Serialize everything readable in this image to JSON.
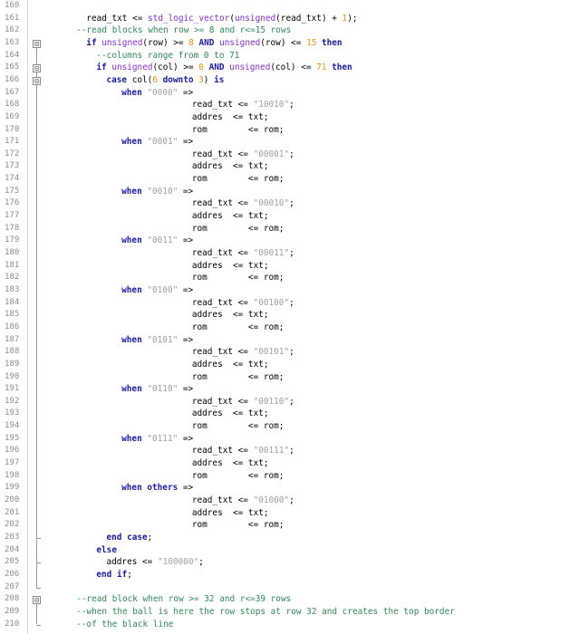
{
  "editor": {
    "line_numbers": [
      "160",
      "161",
      "162",
      "163",
      "164",
      "165",
      "166",
      "167",
      "168",
      "169",
      "170",
      "171",
      "172",
      "173",
      "174",
      "175",
      "176",
      "177",
      "178",
      "179",
      "180",
      "181",
      "182",
      "183",
      "184",
      "185",
      "186",
      "187",
      "188",
      "189",
      "190",
      "191",
      "192",
      "193",
      "194",
      "195",
      "196",
      "197",
      "198",
      "199",
      "200",
      "201",
      "202",
      "203",
      "204",
      "205",
      "206",
      "207",
      "208",
      "209",
      "210"
    ],
    "colors": {
      "keyword": "#1a1aa6",
      "function": "#8a2be2",
      "string": "#a0a0a0",
      "number": "#ff8c00",
      "comment": "#2e8b57",
      "gutter_text": "#8c8c8c"
    },
    "lines": [
      {
        "indent": 0,
        "tokens": []
      },
      {
        "indent": 6,
        "tokens": [
          [
            "t",
            "read_txt <= "
          ],
          [
            "fn",
            "std_logic_vector"
          ],
          [
            "t",
            "("
          ],
          [
            "fn",
            "unsigned"
          ],
          [
            "t",
            "(read_txt) + "
          ],
          [
            "num",
            "1"
          ],
          [
            "t",
            ");"
          ]
        ]
      },
      {
        "indent": 4,
        "tokens": [
          [
            "cm",
            "--read blocks when row >= 8 and r<=15 rows"
          ]
        ]
      },
      {
        "indent": 6,
        "tokens": [
          [
            "kw",
            "if "
          ],
          [
            "fn",
            "unsigned"
          ],
          [
            "t",
            "(row) >= "
          ],
          [
            "num",
            "8"
          ],
          [
            "kw",
            " AND "
          ],
          [
            "fn",
            "unsigned"
          ],
          [
            "t",
            "(row) <= "
          ],
          [
            "num",
            "15"
          ],
          [
            "kw",
            " then"
          ]
        ]
      },
      {
        "indent": 8,
        "tokens": [
          [
            "cm",
            "--columns range from 0 to 71"
          ]
        ]
      },
      {
        "indent": 8,
        "tokens": [
          [
            "kw",
            "if "
          ],
          [
            "fn",
            "unsigned"
          ],
          [
            "t",
            "(col) >= "
          ],
          [
            "num",
            "0"
          ],
          [
            "kw",
            " AND "
          ],
          [
            "fn",
            "unsigned"
          ],
          [
            "t",
            "(col) <= "
          ],
          [
            "num",
            "71"
          ],
          [
            "kw",
            " then"
          ]
        ]
      },
      {
        "indent": 10,
        "tokens": [
          [
            "kw",
            "case "
          ],
          [
            "t",
            "col("
          ],
          [
            "num",
            "6"
          ],
          [
            "kw",
            " downto "
          ],
          [
            "num",
            "3"
          ],
          [
            "t",
            ") "
          ],
          [
            "kw",
            "is"
          ]
        ]
      },
      {
        "indent": 13,
        "tokens": [
          [
            "kw",
            "when "
          ],
          [
            "str",
            "\"0000\""
          ],
          [
            "t",
            " =>"
          ]
        ]
      },
      {
        "indent": 27,
        "tokens": [
          [
            "t",
            "read_txt <= "
          ],
          [
            "str",
            "\"10010\""
          ],
          [
            "t",
            ";"
          ]
        ]
      },
      {
        "indent": 27,
        "tokens": [
          [
            "t",
            "addres  <= txt;"
          ]
        ]
      },
      {
        "indent": 27,
        "tokens": [
          [
            "t",
            "rom        <= rom;"
          ]
        ]
      },
      {
        "indent": 13,
        "tokens": [
          [
            "kw",
            "when "
          ],
          [
            "str",
            "\"0001\""
          ],
          [
            "t",
            " =>"
          ]
        ]
      },
      {
        "indent": 27,
        "tokens": [
          [
            "t",
            "read_txt <= "
          ],
          [
            "str",
            "\"00001\""
          ],
          [
            "t",
            ";"
          ]
        ]
      },
      {
        "indent": 27,
        "tokens": [
          [
            "t",
            "addres  <= txt;"
          ]
        ]
      },
      {
        "indent": 27,
        "tokens": [
          [
            "t",
            "rom        <= rom;"
          ]
        ]
      },
      {
        "indent": 13,
        "tokens": [
          [
            "kw",
            "when "
          ],
          [
            "str",
            "\"0010\""
          ],
          [
            "t",
            " =>"
          ]
        ]
      },
      {
        "indent": 27,
        "tokens": [
          [
            "t",
            "read_txt <= "
          ],
          [
            "str",
            "\"00010\""
          ],
          [
            "t",
            ";"
          ]
        ]
      },
      {
        "indent": 27,
        "tokens": [
          [
            "t",
            "addres  <= txt;"
          ]
        ]
      },
      {
        "indent": 27,
        "tokens": [
          [
            "t",
            "rom        <= rom;"
          ]
        ]
      },
      {
        "indent": 13,
        "tokens": [
          [
            "kw",
            "when "
          ],
          [
            "str",
            "\"0011\""
          ],
          [
            "t",
            " =>"
          ]
        ]
      },
      {
        "indent": 27,
        "tokens": [
          [
            "t",
            "read_txt <= "
          ],
          [
            "str",
            "\"00011\""
          ],
          [
            "t",
            ";"
          ]
        ]
      },
      {
        "indent": 27,
        "tokens": [
          [
            "t",
            "addres  <= txt;"
          ]
        ]
      },
      {
        "indent": 27,
        "tokens": [
          [
            "t",
            "rom        <= rom;"
          ]
        ]
      },
      {
        "indent": 13,
        "tokens": [
          [
            "kw",
            "when "
          ],
          [
            "str",
            "\"0100\""
          ],
          [
            "t",
            " =>"
          ]
        ]
      },
      {
        "indent": 27,
        "tokens": [
          [
            "t",
            "read_txt <= "
          ],
          [
            "str",
            "\"00100\""
          ],
          [
            "t",
            ";"
          ]
        ]
      },
      {
        "indent": 27,
        "tokens": [
          [
            "t",
            "addres  <= txt;"
          ]
        ]
      },
      {
        "indent": 27,
        "tokens": [
          [
            "t",
            "rom        <= rom;"
          ]
        ]
      },
      {
        "indent": 13,
        "tokens": [
          [
            "kw",
            "when "
          ],
          [
            "str",
            "\"0101\""
          ],
          [
            "t",
            " =>"
          ]
        ]
      },
      {
        "indent": 27,
        "tokens": [
          [
            "t",
            "read_txt <= "
          ],
          [
            "str",
            "\"00101\""
          ],
          [
            "t",
            ";"
          ]
        ]
      },
      {
        "indent": 27,
        "tokens": [
          [
            "t",
            "addres  <= txt;"
          ]
        ]
      },
      {
        "indent": 27,
        "tokens": [
          [
            "t",
            "rom        <= rom;"
          ]
        ]
      },
      {
        "indent": 13,
        "tokens": [
          [
            "kw",
            "when "
          ],
          [
            "str",
            "\"0110\""
          ],
          [
            "t",
            " =>"
          ]
        ]
      },
      {
        "indent": 27,
        "tokens": [
          [
            "t",
            "read_txt <= "
          ],
          [
            "str",
            "\"00110\""
          ],
          [
            "t",
            ";"
          ]
        ]
      },
      {
        "indent": 27,
        "tokens": [
          [
            "t",
            "addres  <= txt;"
          ]
        ]
      },
      {
        "indent": 27,
        "tokens": [
          [
            "t",
            "rom        <= rom;"
          ]
        ]
      },
      {
        "indent": 13,
        "tokens": [
          [
            "kw",
            "when "
          ],
          [
            "str",
            "\"0111\""
          ],
          [
            "t",
            " =>"
          ]
        ]
      },
      {
        "indent": 27,
        "tokens": [
          [
            "t",
            "read_txt <= "
          ],
          [
            "str",
            "\"00111\""
          ],
          [
            "t",
            ";"
          ]
        ]
      },
      {
        "indent": 27,
        "tokens": [
          [
            "t",
            "addres  <= txt;"
          ]
        ]
      },
      {
        "indent": 27,
        "tokens": [
          [
            "t",
            "rom        <= rom;"
          ]
        ]
      },
      {
        "indent": 13,
        "tokens": [
          [
            "kw",
            "when others"
          ],
          [
            "t",
            " =>"
          ]
        ]
      },
      {
        "indent": 27,
        "tokens": [
          [
            "t",
            "read_txt <= "
          ],
          [
            "str",
            "\"01000\""
          ],
          [
            "t",
            ";"
          ]
        ]
      },
      {
        "indent": 27,
        "tokens": [
          [
            "t",
            "addres  <= txt;"
          ]
        ]
      },
      {
        "indent": 27,
        "tokens": [
          [
            "t",
            "rom        <= rom;"
          ]
        ]
      },
      {
        "indent": 10,
        "tokens": [
          [
            "kw",
            "end case"
          ],
          [
            "t",
            ";"
          ]
        ]
      },
      {
        "indent": 8,
        "tokens": [
          [
            "kw",
            "else"
          ]
        ]
      },
      {
        "indent": 10,
        "tokens": [
          [
            "t",
            "addres <= "
          ],
          [
            "str",
            "\"100000\""
          ],
          [
            "t",
            ";"
          ]
        ]
      },
      {
        "indent": 8,
        "tokens": [
          [
            "kw",
            "end if"
          ],
          [
            "t",
            ";"
          ]
        ]
      },
      {
        "indent": 0,
        "tokens": []
      },
      {
        "indent": 4,
        "tokens": [
          [
            "cm",
            "--read block when row >= 32 and r<=39 rows"
          ]
        ]
      },
      {
        "indent": 4,
        "tokens": [
          [
            "cm",
            "--when the ball is here the row stops at row 32 and creates the top border"
          ]
        ]
      },
      {
        "indent": 4,
        "tokens": [
          [
            "cm",
            "--of the black line"
          ]
        ]
      }
    ],
    "fold_markers": [
      {
        "line": 3,
        "type": "box",
        "glyph": "⊟",
        "span_end": 47
      },
      {
        "line": 5,
        "type": "box",
        "glyph": "⊟",
        "span_end": 45
      },
      {
        "line": 6,
        "type": "box",
        "glyph": "⊟",
        "span_end": 43
      },
      {
        "line": 48,
        "type": "box",
        "glyph": "⊟",
        "span_end": 50
      }
    ]
  }
}
